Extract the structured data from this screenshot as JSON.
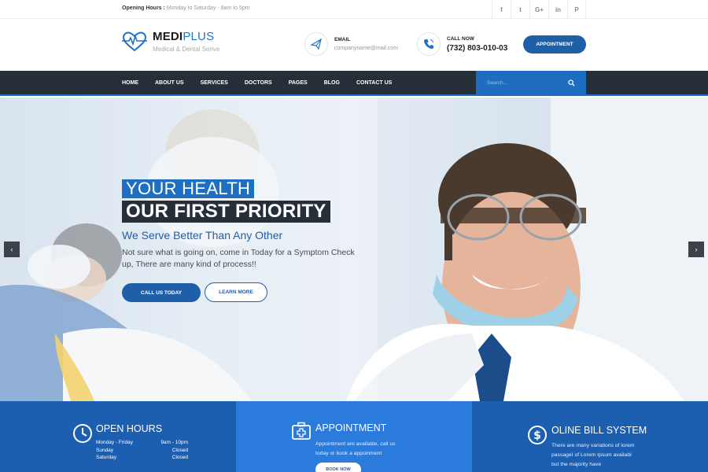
{
  "topbar": {
    "hours_label": "Opening Hours :",
    "hours_value": "Monday to Saturday - 8am to 5pm",
    "social": [
      {
        "icon": "facebook-icon",
        "glyph": "f"
      },
      {
        "icon": "twitter-icon",
        "glyph": "t"
      },
      {
        "icon": "google-plus-icon",
        "glyph": "G+"
      },
      {
        "icon": "linkedin-icon",
        "glyph": "in"
      },
      {
        "icon": "pinterest-icon",
        "glyph": "P"
      }
    ]
  },
  "header": {
    "logo_main": "MEDI",
    "logo_accent": "PLUS",
    "logo_tagline": "Medical & Dental Serive",
    "email_label": "EMAIL",
    "email_value": "companyname@mail.com",
    "call_label": "CALL NOW",
    "call_value": "(732) 803-010-03",
    "appointment_button": "APPOINTMENT"
  },
  "nav": {
    "items": [
      "HOME",
      "ABOUT US",
      "SERVICES",
      "DOCTORS",
      "PAGES",
      "BLOG",
      "CONTACT US"
    ],
    "search_placeholder": "Search..."
  },
  "hero": {
    "line1": "YOUR HEALTH",
    "line2": "OUR FIRST PRIORITY",
    "subtitle": "We Serve Better Than Any Other",
    "description": "Not sure what is going on, come in Today for a Symptom Check up, There are many kind of process!!",
    "call_button": "CALL US TODAY",
    "learn_button": "LEARN MORE",
    "prev_arrow": "‹",
    "next_arrow": "›"
  },
  "features": {
    "open_hours": {
      "title": "OPEN HOURS",
      "rows": [
        {
          "day": "Monday - Friday",
          "time": "9am - 10pm"
        },
        {
          "day": "Sunday",
          "time": "Closed"
        },
        {
          "day": "Saturday",
          "time": "Closed"
        }
      ]
    },
    "appointment": {
      "title": "APPOINTMENT",
      "text_line1": "Appointment are available, call us",
      "text_line2": "today or book a appoinment",
      "button": "BOOK NOW"
    },
    "bill": {
      "title": "OLINE BILL SYSTEM",
      "text_line1": "There are many variations of lorem",
      "text_line2": "passageI of Lorem Ipsum availabl",
      "text_line3": "but the majority have"
    }
  },
  "colors": {
    "brand_blue": "#1e5fa8",
    "accent_blue": "#1e73c6",
    "nav_dark": "#262f38"
  }
}
